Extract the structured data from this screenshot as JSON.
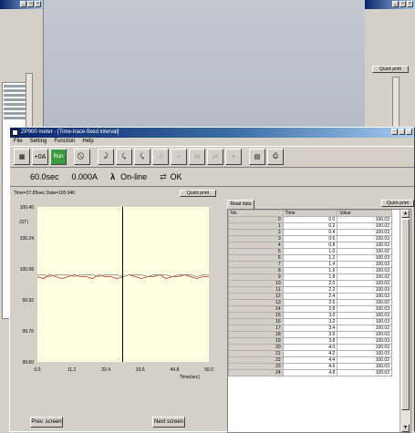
{
  "background_window": {
    "quick_print_label": "Quick print",
    "winbtn_labels": [
      "_",
      "□",
      "×"
    ]
  },
  "window": {
    "title": "ZP900 meter - [Time-trace-fixed interval]",
    "menu": [
      "File",
      "Setting",
      "Function",
      "Help"
    ],
    "window_buttons": [
      "_",
      "□",
      "×"
    ]
  },
  "toolbar": {
    "buttons": [
      {
        "icon": "meter-icon",
        "label": "▦"
      },
      {
        "icon": "zero-current-icon",
        "label": "+0A"
      },
      {
        "icon": "run-icon",
        "label": "Run"
      },
      {
        "icon": "stop-icon",
        "label": "⃠"
      },
      {
        "icon": "scan-icon",
        "label": "⤸"
      },
      {
        "icon": "scan2-icon",
        "label": "⤹"
      },
      {
        "icon": "scan3-icon",
        "label": "⤹"
      },
      {
        "icon": "disabled-icon-1",
        "label": "⤸"
      },
      {
        "icon": "disabled-icon-2",
        "label": "⌁"
      },
      {
        "icon": "disabled-icon-3",
        "label": "W"
      },
      {
        "icon": "disabled-icon-4",
        "label": "⇄"
      },
      {
        "icon": "disabled-icon-5",
        "label": "≡"
      },
      {
        "icon": "report-icon",
        "label": "▤"
      },
      {
        "icon": "print-icon",
        "label": "⎙"
      }
    ]
  },
  "status": {
    "interval": "60.0sec",
    "current": "0.000A",
    "lambda": "λ",
    "mode": "On-line",
    "state": "OK"
  },
  "chart_panel": {
    "header": "Time=27.85sec  Data=100.040",
    "quick_print": "Quick print",
    "prev_label": "Prev. screen",
    "next_label": "Next screen"
  },
  "chart_data": {
    "type": "line",
    "ylabel": "(ST)",
    "xlabel": "Time(sec)",
    "xlim": [
      0,
      56
    ],
    "ylim": [
      99.6,
      100.4
    ],
    "x_ticks": [
      "0.0",
      "11.2",
      "22.4",
      "33.6",
      "44.8",
      "56.0"
    ],
    "y_ticks": [
      "100.40",
      "100.24",
      "100.08",
      "99.92",
      "99.76",
      "99.60"
    ],
    "cursor_x": 27.85,
    "series": [
      {
        "color": "#c03030",
        "values_mean": 100.04,
        "x": [
          0,
          2,
          4,
          6,
          8,
          10,
          12,
          14,
          16,
          18,
          20,
          22,
          24,
          26,
          28,
          30,
          32,
          34,
          36,
          38,
          40,
          42,
          44,
          46,
          48,
          50,
          52,
          54,
          56
        ],
        "y": [
          100.04,
          100.03,
          100.05,
          100.04,
          100.03,
          100.04,
          100.05,
          100.04,
          100.04,
          100.03,
          100.05,
          100.04,
          100.04,
          100.03,
          100.04,
          100.05,
          100.04,
          100.03,
          100.04,
          100.04,
          100.05,
          100.03,
          100.04,
          100.04,
          100.05,
          100.04,
          100.03,
          100.04,
          100.04
        ]
      },
      {
        "color": "#808080",
        "x": [
          0,
          2,
          4,
          6,
          8,
          10,
          12,
          14,
          16,
          18,
          20,
          22,
          24,
          26,
          28,
          30,
          32,
          34,
          36,
          38,
          40,
          42,
          44,
          46,
          48,
          50,
          52,
          54,
          56
        ],
        "y": [
          100.05,
          100.05,
          100.04,
          100.05,
          100.05,
          100.05,
          100.04,
          100.05,
          100.05,
          100.05,
          100.04,
          100.05,
          100.05,
          100.05,
          100.04,
          100.05,
          100.05,
          100.05,
          100.04,
          100.05,
          100.05,
          100.05,
          100.04,
          100.05,
          100.05,
          100.05,
          100.04,
          100.05,
          100.05
        ]
      }
    ]
  },
  "data_panel": {
    "tab": "Read data",
    "quick_print": "Quick print",
    "columns": [
      "No.",
      "Time",
      "Value"
    ],
    "rows": [
      [
        "0",
        "0.0",
        "100.03"
      ],
      [
        "1",
        "0.2",
        "100.02"
      ],
      [
        "2",
        "0.4",
        "100.03"
      ],
      [
        "3",
        "0.6",
        "100.03"
      ],
      [
        "4",
        "0.8",
        "100.03"
      ],
      [
        "5",
        "1.0",
        "100.02"
      ],
      [
        "6",
        "1.2",
        "100.03"
      ],
      [
        "7",
        "1.4",
        "100.03"
      ],
      [
        "8",
        "1.6",
        "100.03"
      ],
      [
        "9",
        "1.8",
        "100.02"
      ],
      [
        "10",
        "2.0",
        "100.03"
      ],
      [
        "11",
        "2.2",
        "100.03"
      ],
      [
        "12",
        "2.4",
        "100.03"
      ],
      [
        "13",
        "2.6",
        "100.02"
      ],
      [
        "14",
        "2.8",
        "100.03"
      ],
      [
        "15",
        "3.0",
        "100.03"
      ],
      [
        "16",
        "3.2",
        "100.03"
      ],
      [
        "17",
        "3.4",
        "100.02"
      ],
      [
        "18",
        "3.6",
        "100.03"
      ],
      [
        "19",
        "3.8",
        "100.03"
      ],
      [
        "20",
        "4.0",
        "100.03"
      ],
      [
        "21",
        "4.2",
        "100.03"
      ],
      [
        "22",
        "4.4",
        "100.02"
      ],
      [
        "23",
        "4.6",
        "100.03"
      ],
      [
        "24",
        "4.8",
        "100.03"
      ]
    ]
  }
}
